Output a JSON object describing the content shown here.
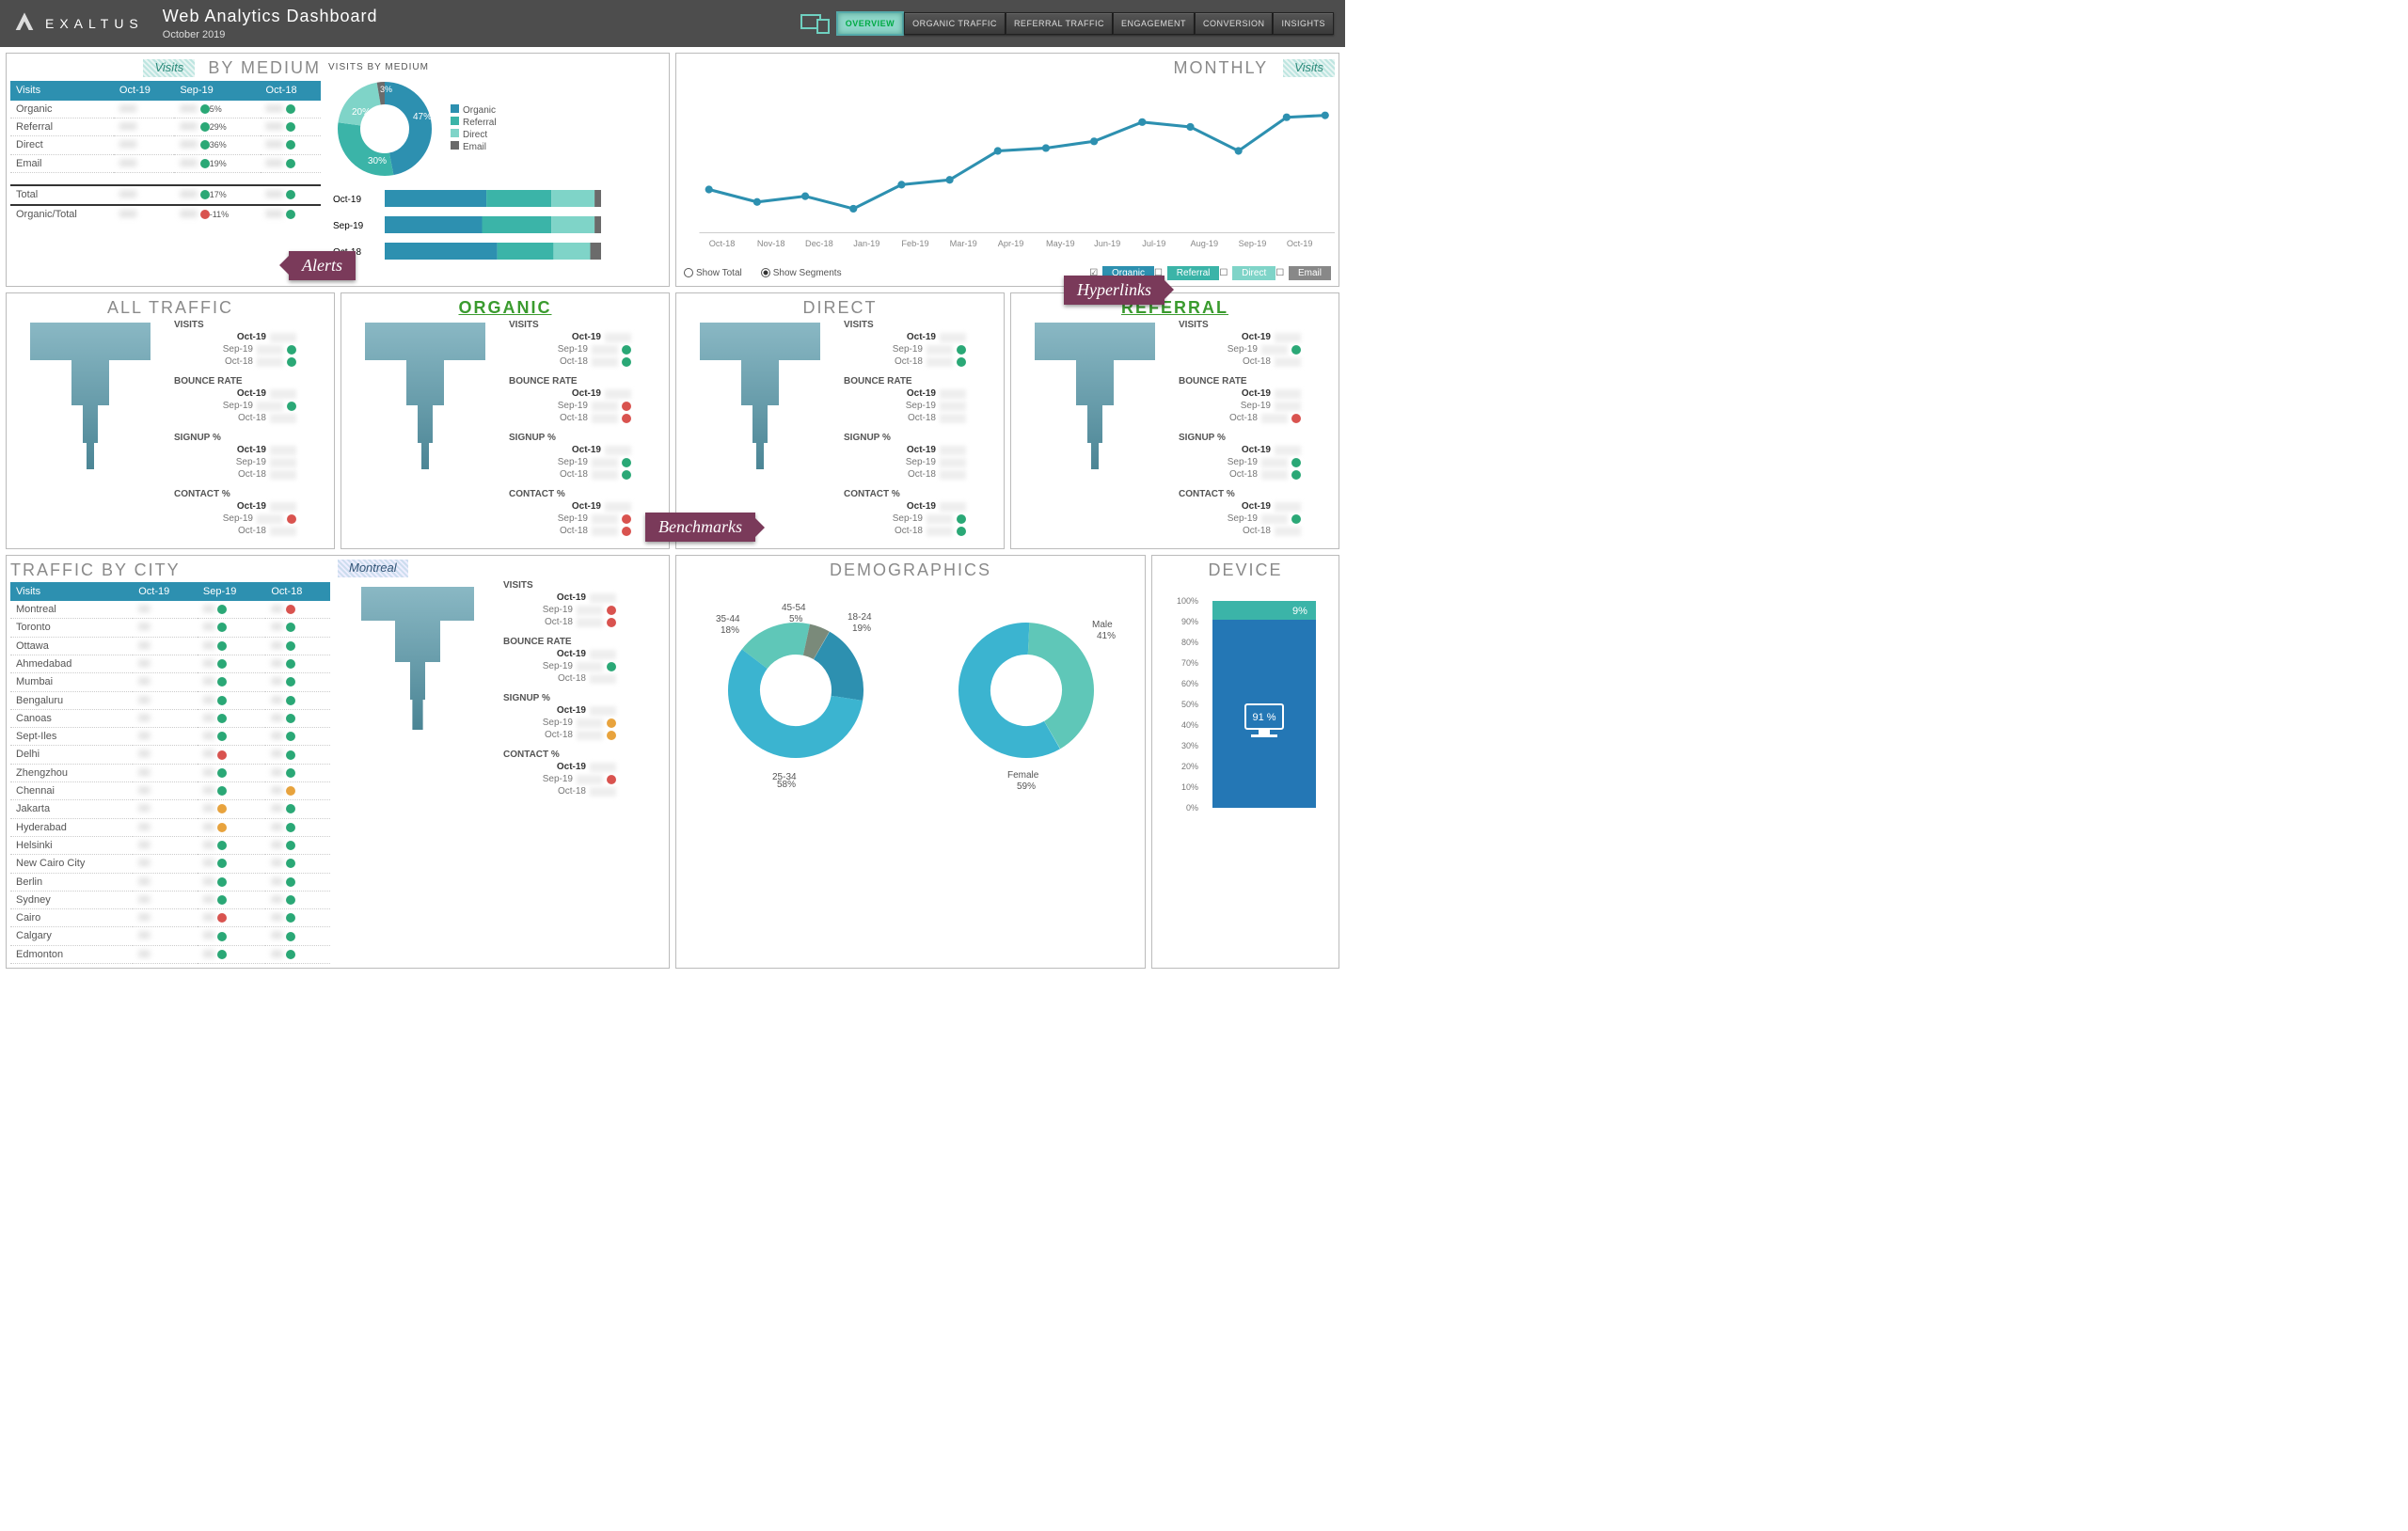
{
  "header": {
    "brand": "EXALTUS",
    "title": "Web Analytics Dashboard",
    "subtitle": "October 2019",
    "nav": [
      "OVERVIEW",
      "ORGANIC TRAFFIC",
      "REFERRAL TRAFFIC",
      "ENGAGEMENT",
      "CONVERSION",
      "INSIGHTS"
    ],
    "active": "OVERVIEW"
  },
  "visits_by_medium": {
    "pill": "Visits",
    "title": "BY MEDIUM",
    "cols": [
      "Visits",
      "Oct-19",
      "Sep-19",
      "Oct-18"
    ],
    "rows": [
      {
        "label": "Organic",
        "sep": {
          "pct": "5%",
          "dot": "g"
        }
      },
      {
        "label": "Referral",
        "sep": {
          "pct": "29%",
          "dot": "g"
        }
      },
      {
        "label": "Direct",
        "sep": {
          "pct": "36%",
          "dot": "g"
        }
      },
      {
        "label": "Email",
        "sep": {
          "pct": "19%",
          "dot": "g"
        }
      }
    ],
    "totals": [
      {
        "label": "Total",
        "sep": {
          "pct": "17%",
          "dot": "g"
        }
      },
      {
        "label": "Organic/Total",
        "sep": {
          "pct": "-11%",
          "dot": "r"
        }
      }
    ],
    "chart_title": "VISITS BY MEDIUM",
    "legend": [
      "Organic",
      "Referral",
      "Direct",
      "Email"
    ],
    "bars_periods": [
      "Oct-19",
      "Sep-19",
      "Oct-18"
    ]
  },
  "callouts": {
    "alerts": "Alerts",
    "hyper": "Hyperlinks",
    "bench": "Benchmarks"
  },
  "monthly": {
    "title": "MONTHLY",
    "pill": "Visits",
    "show_total": "Show Total",
    "show_segments": "Show Segments",
    "segments": [
      "Organic",
      "Referral",
      "Direct",
      "Email"
    ]
  },
  "traffic_boxes": [
    {
      "title": "ALL TRAFFIC",
      "link": false
    },
    {
      "title": "ORGANIC",
      "link": true
    },
    {
      "title": "DIRECT",
      "link": false
    },
    {
      "title": "REFERRAL",
      "link": true
    }
  ],
  "metrics": [
    "VISITS",
    "BOUNCE RATE",
    "SIGNUP %",
    "CONTACT %"
  ],
  "periods": [
    "Oct-19",
    "Sep-19",
    "Oct-18"
  ],
  "traffic_dots": {
    "ALL TRAFFIC": {
      "VISITS": [
        "",
        "g",
        "g"
      ],
      "BOUNCE RATE": [
        "",
        "g",
        ""
      ],
      "SIGNUP %": [
        "",
        "",
        ""
      ],
      "CONTACT %": [
        "",
        "r",
        ""
      ]
    },
    "ORGANIC": {
      "VISITS": [
        "",
        "g",
        "g"
      ],
      "BOUNCE RATE": [
        "",
        "r",
        "r"
      ],
      "SIGNUP %": [
        "",
        "g",
        "g"
      ],
      "CONTACT %": [
        "",
        "r",
        "r"
      ]
    },
    "DIRECT": {
      "VISITS": [
        "",
        "g",
        "g"
      ],
      "BOUNCE RATE": [
        "",
        "",
        ""
      ],
      "SIGNUP %": [
        "",
        "",
        ""
      ],
      "CONTACT %": [
        "",
        "g",
        "g"
      ]
    },
    "REFERRAL": {
      "VISITS": [
        "",
        "g",
        ""
      ],
      "BOUNCE RATE": [
        "",
        "",
        "r"
      ],
      "SIGNUP %": [
        "",
        "g",
        "g"
      ],
      "CONTACT %": [
        "",
        "g",
        ""
      ]
    }
  },
  "city": {
    "title": "TRAFFIC BY CITY",
    "cols": [
      "Visits",
      "Oct-19",
      "Sep-19",
      "Oct-18"
    ],
    "cities": [
      "Montreal",
      "Toronto",
      "Ottawa",
      "Ahmedabad",
      "Mumbai",
      "Bengaluru",
      "Canoas",
      "Sept-Iles",
      "Delhi",
      "Zhengzhou",
      "Chennai",
      "Jakarta",
      "Hyderabad",
      "Helsinki",
      "New Cairo City",
      "Berlin",
      "Sydney",
      "Cairo",
      "Calgary",
      "Edmonton"
    ],
    "dots": [
      [
        "g",
        "r",
        "r"
      ],
      [
        "g",
        "g",
        "g"
      ],
      [
        "g",
        "g",
        "r"
      ],
      [
        "g",
        "g",
        "g"
      ],
      [
        "g",
        "g",
        "r"
      ],
      [
        "g",
        "g",
        "r"
      ],
      [
        "g",
        "g",
        "g"
      ],
      [
        "g",
        "g",
        "g"
      ],
      [
        "r",
        "g",
        "g"
      ],
      [
        "g",
        "g",
        "r"
      ],
      [
        "g",
        "y",
        "g"
      ],
      [
        "y",
        "g",
        "g"
      ],
      [
        "y",
        "g",
        "y"
      ],
      [
        "g",
        "g",
        "g"
      ],
      [
        "g",
        "g",
        "r"
      ],
      [
        "g",
        "g",
        "g"
      ],
      [
        "g",
        "g",
        "g"
      ],
      [
        "r",
        "g",
        "g"
      ],
      [
        "g",
        "g",
        "g"
      ],
      [
        "g",
        "g",
        "g"
      ]
    ],
    "detail_city": "Montreal",
    "detail_dots": {
      "VISITS": [
        "",
        "r",
        "r"
      ],
      "BOUNCE RATE": [
        "",
        "g",
        ""
      ],
      "SIGNUP %": [
        "",
        "y",
        "y"
      ],
      "CONTACT %": [
        "",
        "r",
        ""
      ]
    }
  },
  "demographics": {
    "title": "DEMOGRAPHICS"
  },
  "device": {
    "title": "DEVICE",
    "desktop": "91 %",
    "mobile": "9%"
  },
  "chart_data": {
    "donut_medium": {
      "type": "pie",
      "title": "VISITS BY MEDIUM",
      "series": [
        {
          "name": "Organic",
          "value": 47
        },
        {
          "name": "Referral",
          "value": 30
        },
        {
          "name": "Direct",
          "value": 20
        },
        {
          "name": "Email",
          "value": 3
        }
      ]
    },
    "stacked_bars": {
      "type": "bar_stacked",
      "categories": [
        "Oct-19",
        "Sep-19",
        "Oct-18"
      ],
      "segments": [
        "Organic",
        "Referral",
        "Direct",
        "Email"
      ],
      "values": [
        [
          47,
          30,
          20,
          3
        ],
        [
          45,
          32,
          20,
          3
        ],
        [
          52,
          26,
          17,
          5
        ]
      ]
    },
    "monthly_line": {
      "type": "line",
      "x": [
        "Oct-18",
        "Nov-18",
        "Dec-18",
        "Jan-19",
        "Feb-19",
        "Mar-19",
        "Apr-19",
        "May-19",
        "Jun-19",
        "Jul-19",
        "Aug-19",
        "Sep-19",
        "Oct-19"
      ],
      "values": [
        38,
        32,
        35,
        30,
        40,
        43,
        55,
        58,
        60,
        70,
        68,
        58,
        75,
        78
      ]
    },
    "age_donut": {
      "type": "pie",
      "series": [
        {
          "name": "18-24",
          "value": 19
        },
        {
          "name": "25-34",
          "value": 58
        },
        {
          "name": "35-44",
          "value": 18
        },
        {
          "name": "45-54",
          "value": 5
        }
      ]
    },
    "gender_donut": {
      "type": "pie",
      "series": [
        {
          "name": "Female",
          "value": 59
        },
        {
          "name": "Male",
          "value": 41
        }
      ]
    },
    "device_bar": {
      "type": "bar_stacked",
      "categories": [
        "Device"
      ],
      "series": [
        {
          "name": "Desktop",
          "value": 91
        },
        {
          "name": "Mobile",
          "value": 9
        }
      ],
      "ylim": [
        0,
        100
      ]
    }
  }
}
